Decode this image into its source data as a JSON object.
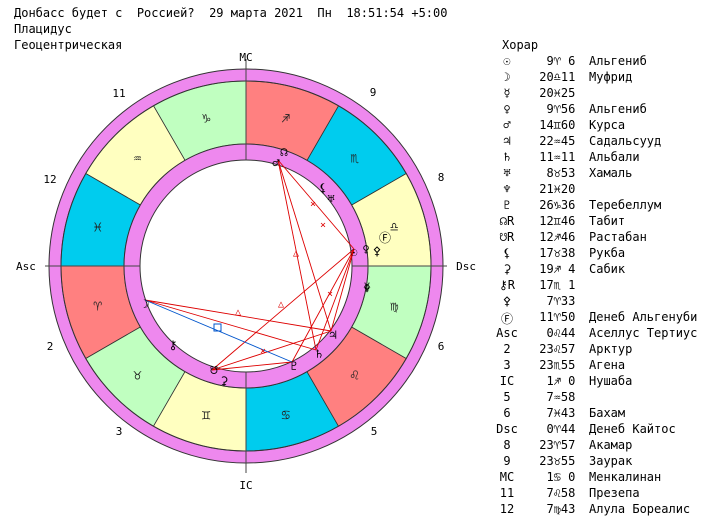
{
  "header": {
    "line1": "Донбасс будет с  Россией?  29 марта 2021  Пн  18:51:54 +5:00",
    "line2": "Плацидус",
    "line3": "Геоцентрическая"
  },
  "axis_labels": {
    "mc": "MC",
    "ic": "IC",
    "asc": "Asc",
    "dsc": "Dsc"
  },
  "house_numbers": [
    "1",
    "2",
    "3",
    "4",
    "5",
    "6",
    "7",
    "8",
    "9",
    "10",
    "11",
    "12"
  ],
  "zodiac": [
    {
      "sign": "aries",
      "glyph": "♈",
      "color": "#ff8080"
    },
    {
      "sign": "taurus",
      "glyph": "♉",
      "color": "#c0ffc0"
    },
    {
      "sign": "gemini",
      "glyph": "♊",
      "color": "#ffffc0"
    },
    {
      "sign": "cancer",
      "glyph": "♋",
      "color": "#00ccee"
    },
    {
      "sign": "leo",
      "glyph": "♌",
      "color": "#ff8080"
    },
    {
      "sign": "virgo",
      "glyph": "♍",
      "color": "#c0ffc0"
    },
    {
      "sign": "libra",
      "glyph": "♎",
      "color": "#ffffc0"
    },
    {
      "sign": "scorpio",
      "glyph": "♏",
      "color": "#00ccee"
    },
    {
      "sign": "sagittarius",
      "glyph": "♐",
      "color": "#ff8080"
    },
    {
      "sign": "capricorn",
      "glyph": "♑",
      "color": "#c0ffc0"
    },
    {
      "sign": "aquarius",
      "glyph": "♒",
      "color": "#ffffc0"
    },
    {
      "sign": "pisces",
      "glyph": "♓",
      "color": "#00ccee"
    }
  ],
  "wheel_colors": {
    "ring": "#ee88ee",
    "aspect_red": "#dd0000",
    "aspect_blue": "#0055cc"
  },
  "table": {
    "title": "Хорар",
    "rows": [
      {
        "glyph": "☉",
        "pos": "  9♈ 6",
        "star": "Альгениб",
        "icon": "sun-icon"
      },
      {
        "glyph": "☽",
        "pos": " 20♎11",
        "star": "Муфрид",
        "icon": "moon-icon"
      },
      {
        "glyph": "☿",
        "pos": " 20♓25",
        "star": "",
        "icon": "mercury-icon"
      },
      {
        "glyph": "♀",
        "pos": "  9♈56",
        "star": "Альгениб",
        "icon": "venus-icon"
      },
      {
        "glyph": "♂",
        "pos": " 14♊60",
        "star": "Курса",
        "icon": "mars-icon"
      },
      {
        "glyph": "♃",
        "pos": " 22♒45",
        "star": "Садальсууд",
        "icon": "jupiter-icon"
      },
      {
        "glyph": "♄",
        "pos": " 11♒11",
        "star": "Альбали",
        "icon": "saturn-icon"
      },
      {
        "glyph": "♅",
        "pos": "  8♉53",
        "star": "Хамаль",
        "icon": "uranus-icon"
      },
      {
        "glyph": "♆",
        "pos": " 21♓20",
        "star": "",
        "icon": "neptune-icon"
      },
      {
        "glyph": "♇",
        "pos": " 26♑36",
        "star": "Теребеллум",
        "icon": "pluto-icon"
      },
      {
        "glyph": "☊R",
        "pos": " 12♊46",
        "star": "Табит",
        "icon": "north-node-icon"
      },
      {
        "glyph": "☋R",
        "pos": " 12♐46",
        "star": "Растабан",
        "icon": "south-node-icon"
      },
      {
        "glyph": "⚸",
        "pos": " 17♉38",
        "star": "Рукба",
        "icon": "lilith-icon"
      },
      {
        "glyph": "⚳",
        "pos": " 19♐ 4",
        "star": "Сабик",
        "icon": "selena-icon"
      },
      {
        "glyph": "⚷R",
        "pos": " 17♏ 1",
        "star": "",
        "icon": "chiron-icon"
      },
      {
        "glyph": "⚴",
        "pos": "  7♈33",
        "star": "",
        "icon": "proserpina-icon"
      },
      {
        "glyph": "Ⓕ",
        "pos": " 11♈50",
        "star": "Денеб Альгенуби",
        "icon": "fortune-icon"
      },
      {
        "glyph": "Asc",
        "pos": "  0♌44",
        "star": "Аселлус Тертиус",
        "icon": ""
      },
      {
        "glyph": "2",
        "pos": " 23♌57",
        "star": "Арктур",
        "icon": ""
      },
      {
        "glyph": "3",
        "pos": " 23♏55",
        "star": "Агена",
        "icon": ""
      },
      {
        "glyph": "IC",
        "pos": "  1♐ 0",
        "star": "Нушаба",
        "icon": ""
      },
      {
        "glyph": "5",
        "pos": "  7♒58",
        "star": "",
        "icon": ""
      },
      {
        "glyph": "6",
        "pos": "  7♓43",
        "star": "Бахам",
        "icon": ""
      },
      {
        "glyph": "Dsc",
        "pos": "  0♈44",
        "star": "Денеб Кайтос",
        "icon": ""
      },
      {
        "glyph": "8",
        "pos": " 23♈57",
        "star": "Акамар",
        "icon": ""
      },
      {
        "glyph": "9",
        "pos": " 23♉55",
        "star": "Заурак",
        "icon": ""
      },
      {
        "glyph": "MC",
        "pos": "  1♋ 0",
        "star": "Менкалинан",
        "icon": ""
      },
      {
        "glyph": "11",
        "pos": "  7♌58",
        "star": "Презепа",
        "icon": ""
      },
      {
        "glyph": "12",
        "pos": "  7♍43",
        "star": "Алула Бореалис",
        "icon": ""
      }
    ]
  }
}
